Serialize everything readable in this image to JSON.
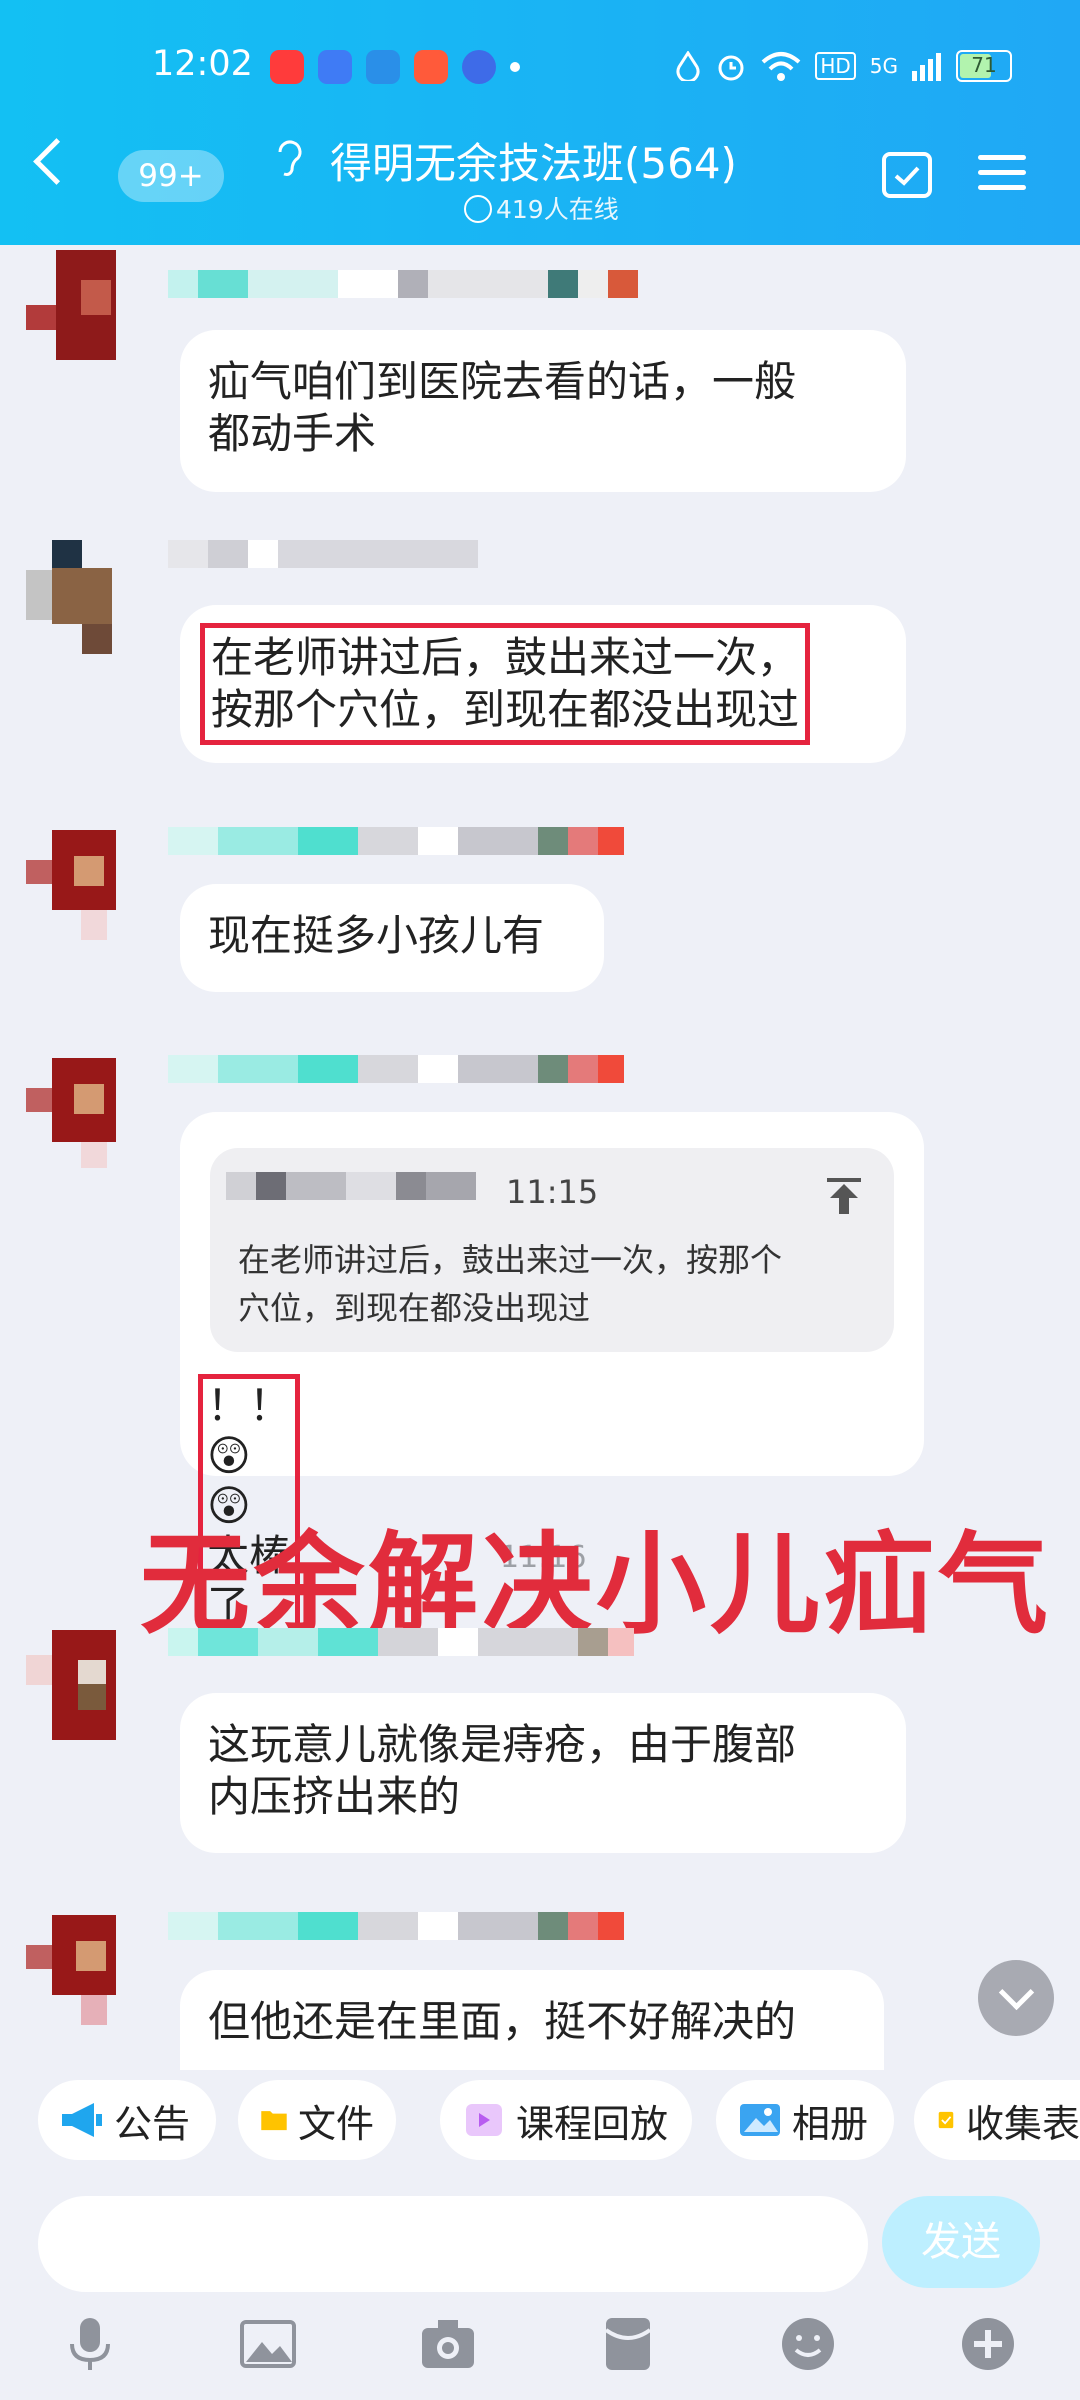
{
  "status_bar": {
    "time": "12:02",
    "hd": "HD",
    "network": "5G",
    "battery": "71",
    "battery_level": 0.71
  },
  "header": {
    "unread_badge": "99+",
    "group_title": "得明无余技法班(564)",
    "online_text": "419人在线"
  },
  "messages": [
    {
      "id": "m1",
      "text_line1": "疝气咱们到医院去看的话，一般",
      "text_line2": "都动手术"
    },
    {
      "id": "m2",
      "text_line1": "在老师讲过后，鼓出来过一次，",
      "text_line2": "按那个穴位，到现在都没出现过",
      "highlighted": true
    },
    {
      "id": "m3",
      "text": "现在挺多小孩儿有"
    },
    {
      "id": "m4",
      "quote": {
        "time": "11:15",
        "text_line1": "在老师讲过后，鼓出来过一次，按那个",
        "text_line2": "穴位，到现在都没出现过"
      },
      "reply_prefix": "！！",
      "reply_emoji": "😲😲",
      "reply_text": "太棒了",
      "highlighted": true
    },
    {
      "id": "m5",
      "text_line1": "这玩意儿就像是痔疮，由于腹部",
      "text_line2": "内压挤出来的"
    },
    {
      "id": "m6",
      "text": "但他还是在里面，挺不好解决的"
    }
  ],
  "overlay_caption": "无余解决小儿疝气",
  "overlay_time": "11:16",
  "toolbar": {
    "chips": [
      {
        "label": "公告",
        "icon": "megaphone-icon",
        "color": "#1fa6ee"
      },
      {
        "label": "文件",
        "icon": "folder-icon",
        "color": "#ffc300"
      },
      {
        "label": "课程回放",
        "icon": "video-icon",
        "color": "#b85cf0"
      },
      {
        "label": "相册",
        "icon": "photo-icon",
        "color": "#3aa4f1"
      },
      {
        "label": "收集表",
        "icon": "checklist-icon",
        "color": "#ffc400"
      }
    ]
  },
  "composer": {
    "send_label": "发送"
  },
  "colors": {
    "header_start": "#13c0f3",
    "header_end": "#20a8f5",
    "highlight_red": "#e5233e",
    "overlay_red": "#e12c3c",
    "send_disabled": "#bdefff"
  }
}
